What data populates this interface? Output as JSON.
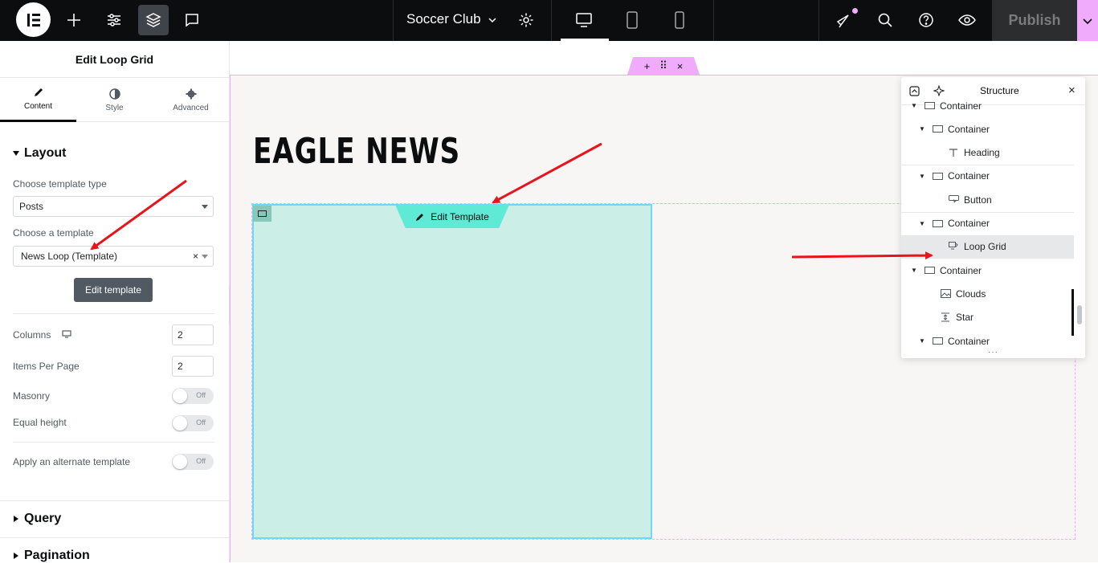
{
  "topbar": {
    "site_name": "Soccer Club",
    "publish_label": "Publish"
  },
  "panel": {
    "title": "Edit Loop Grid",
    "tabs": [
      {
        "label": "Content",
        "icon": "pencil-icon"
      },
      {
        "label": "Style",
        "icon": "half-circle-icon"
      },
      {
        "label": "Advanced",
        "icon": "gear-icon"
      }
    ],
    "layout_label": "Layout",
    "template_type_label": "Choose template type",
    "template_type_value": "Posts",
    "template_label": "Choose a template",
    "template_value": "News Loop (Template)",
    "edit_template_btn": "Edit template",
    "columns_label": "Columns",
    "columns_value": "2",
    "items_per_page_label": "Items Per Page",
    "items_per_page_value": "2",
    "masonry_label": "Masonry",
    "equal_height_label": "Equal height",
    "alternate_label": "Apply an alternate template",
    "toggle_off": "Off",
    "query_label": "Query",
    "pagination_label": "Pagination"
  },
  "canvas": {
    "heading": "EAGLE NEWS",
    "edit_template_tab": "Edit Template"
  },
  "structure": {
    "title": "Structure",
    "items": [
      {
        "label": "Container",
        "level": 0,
        "icon": "container-icon",
        "caret": true
      },
      {
        "label": "Container",
        "level": 1,
        "icon": "container-icon",
        "caret": true
      },
      {
        "label": "Heading",
        "level": 2,
        "icon": "heading-icon",
        "caret": false
      },
      {
        "label": "Container",
        "level": 1,
        "icon": "container-icon",
        "caret": true
      },
      {
        "label": "Button",
        "level": 2,
        "icon": "button-icon",
        "caret": false
      },
      {
        "label": "Container",
        "level": 1,
        "icon": "container-icon",
        "caret": true
      },
      {
        "label": "Loop Grid",
        "level": 2,
        "icon": "loop-grid-icon",
        "caret": false,
        "selected": true
      },
      {
        "label": "Container",
        "level": 0,
        "icon": "container-icon",
        "caret": true
      },
      {
        "label": "Clouds",
        "level": 1,
        "icon": "image-icon",
        "caret": false
      },
      {
        "label": "Star",
        "level": 1,
        "icon": "spacer-icon",
        "caret": false
      },
      {
        "label": "Container",
        "level": 1,
        "icon": "container-icon",
        "caret": true
      }
    ]
  },
  "colors": {
    "accent_pink": "#f0abfc",
    "loop_item_bg": "#cbefe6",
    "loop_item_border": "#71d7f7",
    "edit_tab": "#5eead4",
    "arrow_red": "#e8141c"
  }
}
